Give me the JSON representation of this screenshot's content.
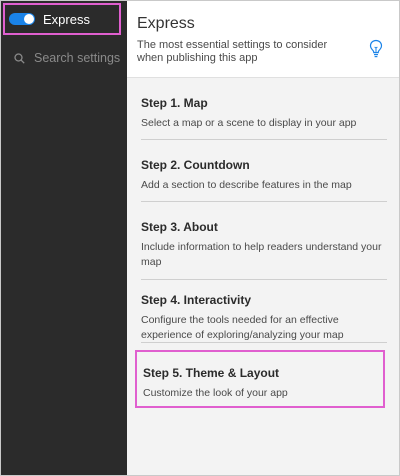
{
  "sidebar": {
    "toggle_label": "Express",
    "search_placeholder": "Search settings"
  },
  "header": {
    "title": "Express",
    "description": "The most essential settings to consider when publishing this app"
  },
  "steps": [
    {
      "title": "Step 1. Map",
      "description": "Select a map or a scene to display in your app"
    },
    {
      "title": "Step 2. Countdown",
      "description": "Add a section to describe features in the map"
    },
    {
      "title": "Step 3. About",
      "description": "Include information to help readers understand your map"
    },
    {
      "title": "Step 4. Interactivity",
      "description": "Configure the tools needed for an effective experience of exploring/analyzing your map"
    },
    {
      "title": "Step 5. Theme & Layout",
      "description": "Customize the look of your app"
    }
  ],
  "colors": {
    "accent": "#1a83e8",
    "highlight": "#e05fcf",
    "sidebar_bg": "#2b2b2b"
  },
  "icons": {
    "search": "search-icon",
    "tip": "lightbulb-icon"
  }
}
